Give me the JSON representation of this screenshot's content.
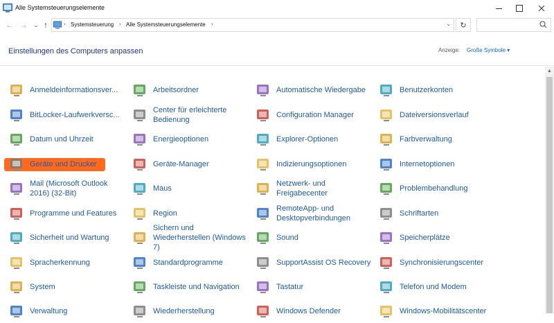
{
  "window": {
    "title": "Alle Systemsteuerungselemente"
  },
  "address": {
    "back": "←",
    "forward": "→",
    "recent": "⌄",
    "up": "↑",
    "crumbs": [
      "Systemsteuerung",
      "Alle Systemsteuerungselemente"
    ],
    "separator": "›",
    "dropdown": "⌄",
    "refresh": "↻"
  },
  "search": {
    "placeholder": ""
  },
  "header": {
    "title": "Einstellungen des Computers anpassen",
    "view_label": "Anzeige:",
    "view_value": "Große Symbole ▾"
  },
  "items": [
    {
      "label": "Anmeldeinformationsver...",
      "icon": "credential-manager-icon"
    },
    {
      "label": "BitLocker-Laufwerkversc...",
      "icon": "bitlocker-icon"
    },
    {
      "label": "Datum und Uhrzeit",
      "icon": "date-time-icon"
    },
    {
      "label": "Geräte und Drucker",
      "icon": "devices-printers-icon"
    },
    {
      "label": "Mail (Microsoft Outlook 2016) (32-Bit)",
      "icon": "mail-icon"
    },
    {
      "label": "Programme und Features",
      "icon": "programs-features-icon"
    },
    {
      "label": "Sicherheit und Wartung",
      "icon": "security-maintenance-icon"
    },
    {
      "label": "Spracherkennung",
      "icon": "speech-recognition-icon"
    },
    {
      "label": "System",
      "icon": "system-icon"
    },
    {
      "label": "Verwaltung",
      "icon": "administration-icon"
    },
    {
      "label": "Arbeitsordner",
      "icon": "work-folders-icon"
    },
    {
      "label": "Center für erleichterte Bedienung",
      "icon": "ease-of-access-icon"
    },
    {
      "label": "Energieoptionen",
      "icon": "power-options-icon"
    },
    {
      "label": "Geräte-Manager",
      "icon": "device-manager-icon"
    },
    {
      "label": "Maus",
      "icon": "mouse-icon"
    },
    {
      "label": "Region",
      "icon": "region-icon"
    },
    {
      "label": "Sichern und Wiederherstellen (Windows 7)",
      "icon": "backup-restore-icon"
    },
    {
      "label": "Standardprogramme",
      "icon": "default-programs-icon"
    },
    {
      "label": "Taskleiste und Navigation",
      "icon": "taskbar-icon"
    },
    {
      "label": "Wiederherstellung",
      "icon": "recovery-icon"
    },
    {
      "label": "Automatische Wiedergabe",
      "icon": "autoplay-icon"
    },
    {
      "label": "Configuration Manager",
      "icon": "configuration-manager-icon"
    },
    {
      "label": "Explorer-Optionen",
      "icon": "explorer-options-icon"
    },
    {
      "label": "Indizierungsoptionen",
      "icon": "indexing-options-icon"
    },
    {
      "label": "Netzwerk- und Freigabecenter",
      "icon": "network-sharing-icon"
    },
    {
      "label": "RemoteApp- und Desktopverbindungen",
      "icon": "remoteapp-icon"
    },
    {
      "label": "Sound",
      "icon": "sound-icon"
    },
    {
      "label": "SupportAssist OS Recovery",
      "icon": "supportassist-icon"
    },
    {
      "label": "Tastatur",
      "icon": "keyboard-icon"
    },
    {
      "label": "Windows Defender",
      "icon": "windows-defender-icon"
    },
    {
      "label": "Benutzerkonten",
      "icon": "user-accounts-icon"
    },
    {
      "label": "Dateiversionsverlauf",
      "icon": "file-history-icon"
    },
    {
      "label": "Farbverwaltung",
      "icon": "color-management-icon"
    },
    {
      "label": "Internetoptionen",
      "icon": "internet-options-icon"
    },
    {
      "label": "Problembehandlung",
      "icon": "troubleshooting-icon"
    },
    {
      "label": "Schriftarten",
      "icon": "fonts-icon"
    },
    {
      "label": "Speicherplätze",
      "icon": "storage-spaces-icon"
    },
    {
      "label": "Synchronisierungscenter",
      "icon": "sync-center-icon"
    },
    {
      "label": "Telefon und Modem",
      "icon": "phone-modem-icon"
    },
    {
      "label": "Windows-Mobilitätscenter",
      "icon": "mobility-center-icon"
    }
  ],
  "highlight_color": "#ff6a1f",
  "link_color": "#1e5aa0"
}
